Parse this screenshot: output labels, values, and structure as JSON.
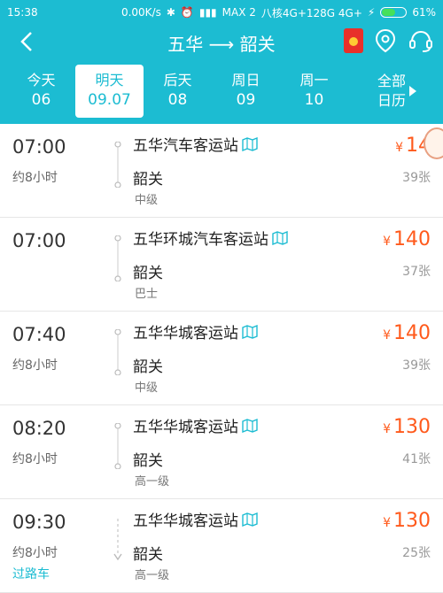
{
  "status": {
    "time": "15:38",
    "speed": "0.00K/s",
    "carrier": "MAX 2",
    "extra": "八核4G+128G 4G+",
    "battery": "61%",
    "battery_level": 0.61
  },
  "header": {
    "route": "五华 ⟶ 韶关"
  },
  "dates": [
    {
      "day": "今天",
      "date": "06"
    },
    {
      "day": "明天",
      "date": "09.07"
    },
    {
      "day": "后天",
      "date": "08"
    },
    {
      "day": "周日",
      "date": "09"
    },
    {
      "day": "周一",
      "date": "10"
    }
  ],
  "all_dates": {
    "line1": "全部",
    "line2": "日历"
  },
  "trips": [
    {
      "time": "07:00",
      "duration": "约8小时",
      "via": "",
      "from": "五华汽车客运站",
      "to": "韶关",
      "grade": "中级",
      "price": "14",
      "seats": "39张"
    },
    {
      "time": "07:00",
      "duration": "",
      "via": "",
      "from": "五华环城汽车客运站",
      "to": "韶关",
      "grade": "巴士",
      "price": "140",
      "seats": "37张"
    },
    {
      "time": "07:40",
      "duration": "约8小时",
      "via": "",
      "from": "五华华城客运站",
      "to": "韶关",
      "grade": "中级",
      "price": "140",
      "seats": "39张"
    },
    {
      "time": "08:20",
      "duration": "约8小时",
      "via": "",
      "from": "五华华城客运站",
      "to": "韶关",
      "grade": "高一级",
      "price": "130",
      "seats": "41张"
    },
    {
      "time": "09:30",
      "duration": "约8小时",
      "via": "过路车",
      "from": "五华华城客运站",
      "to": "韶关",
      "grade": "高一级",
      "price": "130",
      "seats": "25张"
    }
  ],
  "currency": "¥",
  "colors": {
    "accent": "#1cbcd2",
    "price": "#ff5a1c"
  }
}
